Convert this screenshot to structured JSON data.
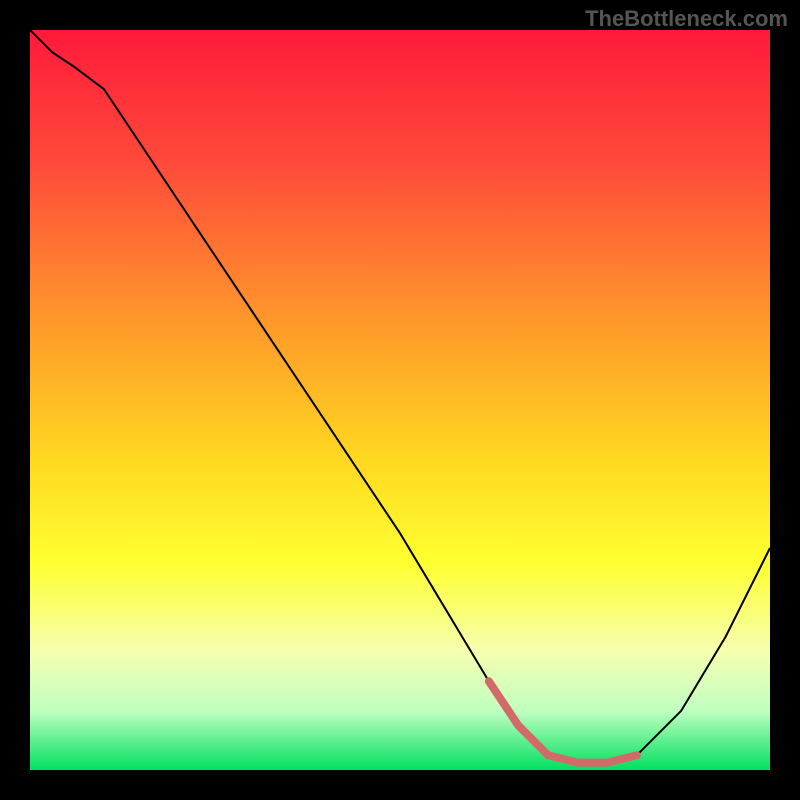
{
  "attribution": "TheBottleneck.com",
  "chart_data": {
    "type": "line",
    "title": "",
    "xlabel": "",
    "ylabel": "",
    "xlim": [
      0,
      100
    ],
    "ylim": [
      0,
      100
    ],
    "gradient_stops": [
      {
        "offset": 0,
        "color": "#ff1a3a"
      },
      {
        "offset": 18,
        "color": "#ff4a3a"
      },
      {
        "offset": 40,
        "color": "#ff9a2a"
      },
      {
        "offset": 58,
        "color": "#ffd820"
      },
      {
        "offset": 72,
        "color": "#ffff30"
      },
      {
        "offset": 84,
        "color": "#f5ffb0"
      },
      {
        "offset": 92,
        "color": "#c0ffc0"
      },
      {
        "offset": 100,
        "color": "#00e060"
      }
    ],
    "series": [
      {
        "name": "bottleneck-curve",
        "color": "#000000",
        "x": [
          0,
          3,
          6,
          10,
          20,
          30,
          40,
          50,
          56,
          62,
          66,
          70,
          74,
          78,
          82,
          88,
          94,
          100
        ],
        "y": [
          100,
          97,
          95,
          92,
          77,
          62,
          47,
          32,
          22,
          12,
          6,
          2,
          1,
          1,
          2,
          8,
          18,
          30
        ]
      },
      {
        "name": "optimal-segment",
        "color": "#d36a6a",
        "stroke_width": 8,
        "x": [
          62,
          66,
          70,
          74,
          78,
          82
        ],
        "y": [
          12,
          6,
          2,
          1,
          1,
          2
        ]
      }
    ]
  }
}
